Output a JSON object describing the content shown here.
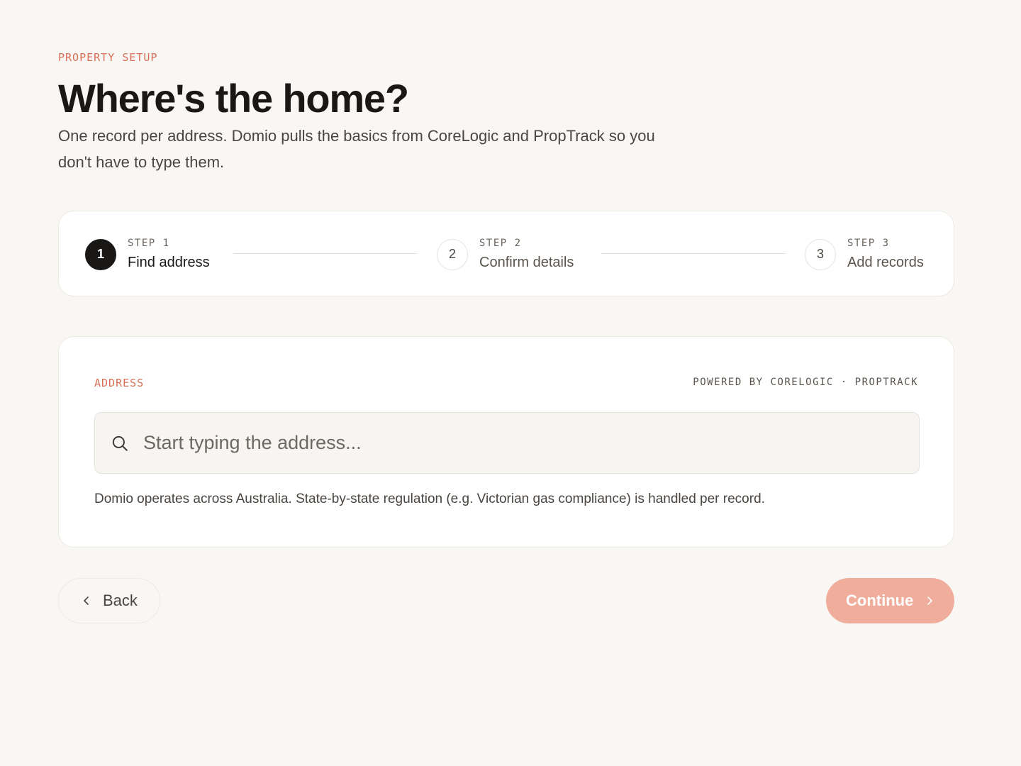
{
  "header": {
    "eyebrow": "PROPERTY SETUP",
    "title": "Where's the home?",
    "subtitle": "One record per address. Domio pulls the basics from CoreLogic and PropTrack so you don't have to type them."
  },
  "stepper": {
    "steps": [
      {
        "number": "1",
        "kicker": "STEP 1",
        "label": "Find address",
        "state": "active"
      },
      {
        "number": "2",
        "kicker": "STEP 2",
        "label": "Confirm details",
        "state": "upcoming"
      },
      {
        "number": "3",
        "kicker": "STEP 3",
        "label": "Add records",
        "state": "upcoming"
      }
    ]
  },
  "address": {
    "label": "ADDRESS",
    "powered_by": "POWERED BY CORELOGIC · PROPTRACK",
    "search_value": "",
    "search_placeholder": "Start typing the address...",
    "search_icon": "search-icon",
    "helper": "Domio operates across Australia. State-by-state regulation (e.g. Victorian gas compliance) is handled per record."
  },
  "footer": {
    "back_label": "Back",
    "back_icon": "chevron-left-icon",
    "continue_label": "Continue",
    "continue_icon": "chevron-right-icon",
    "continue_enabled": false
  },
  "colors": {
    "accent": "#d86f56",
    "accent_disabled": "#f1ad9b",
    "background": "#f9f7f4",
    "active_step": "#1a1816"
  }
}
